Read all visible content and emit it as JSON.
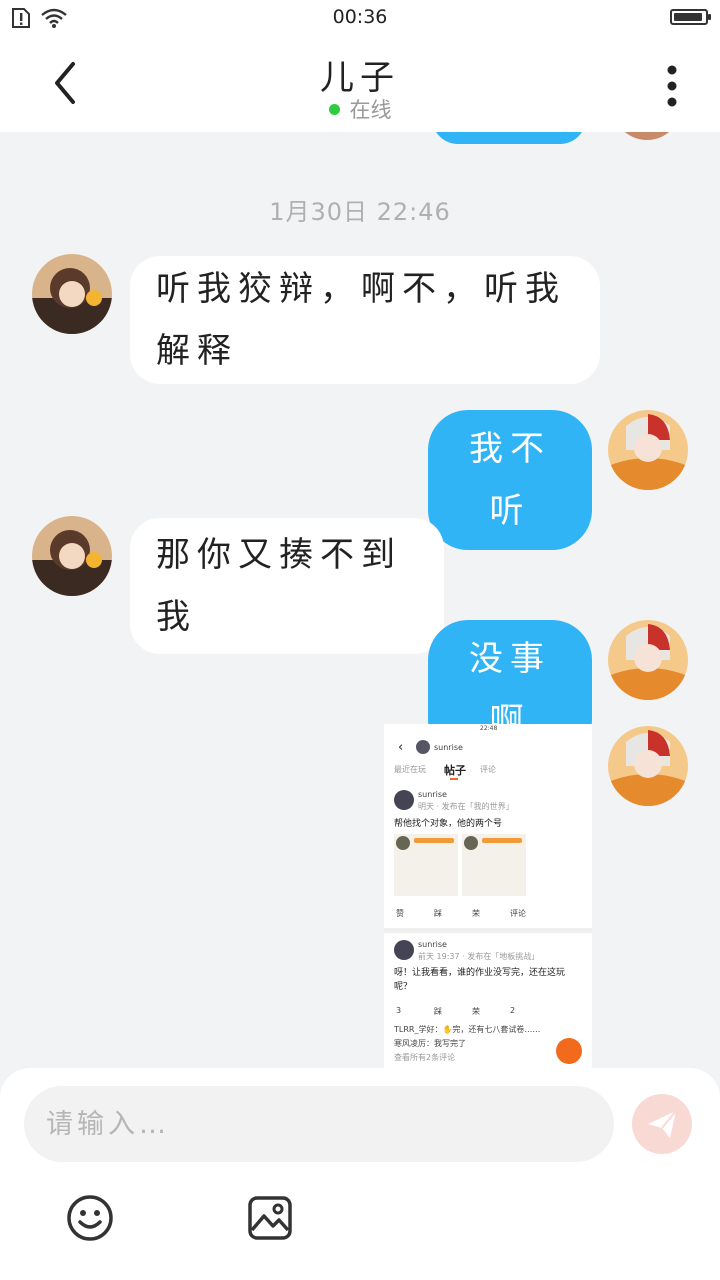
{
  "status_bar": {
    "time": "00:36"
  },
  "header": {
    "title": "儿子",
    "presence": "在线"
  },
  "chat": {
    "timestamp": "1月30日 22:46",
    "messages": [
      {
        "text": "听我狡辩，啊不，听我解释"
      },
      {
        "text": "我不听"
      },
      {
        "text": "那你又揍不到我"
      },
      {
        "text": "没事啊"
      }
    ],
    "screenshot": {
      "time": "22:48",
      "user": "sunrise",
      "tab_recent": "最近在玩",
      "tab_posts": "帖子",
      "tab_comments": "评论",
      "post1_user": "sunrise",
      "post1_meta": "明天 · 发布在「我的世界」",
      "post1_text": "帮他找个对象，他的两个号",
      "post1_actions": [
        "赞",
        "踩",
        "荣",
        "评论"
      ],
      "post2_user": "sunrise",
      "post2_meta": "前天 19:37 · 发布在「地板挑战」",
      "post2_text": "呀！让我看看，谁的作业没写完，还在这玩呢？",
      "post2_actions": [
        "3",
        "踩",
        "荣",
        "2"
      ],
      "comment1": "TLRR_学好：✋完，还有七八套试卷……",
      "comment2": "寒风凌厉：我写完了",
      "more_comments": "查看所有2条评论"
    }
  },
  "composer": {
    "placeholder": "请输入…"
  },
  "colors": {
    "accent": "#30b4f5",
    "online": "#2ecc40",
    "send_disabled": "#f9d9d3"
  },
  "icons": {
    "back": "chevron-left-icon",
    "more": "more-vertical-icon",
    "emoji": "smiley-icon",
    "image": "image-icon",
    "send": "send-icon"
  }
}
